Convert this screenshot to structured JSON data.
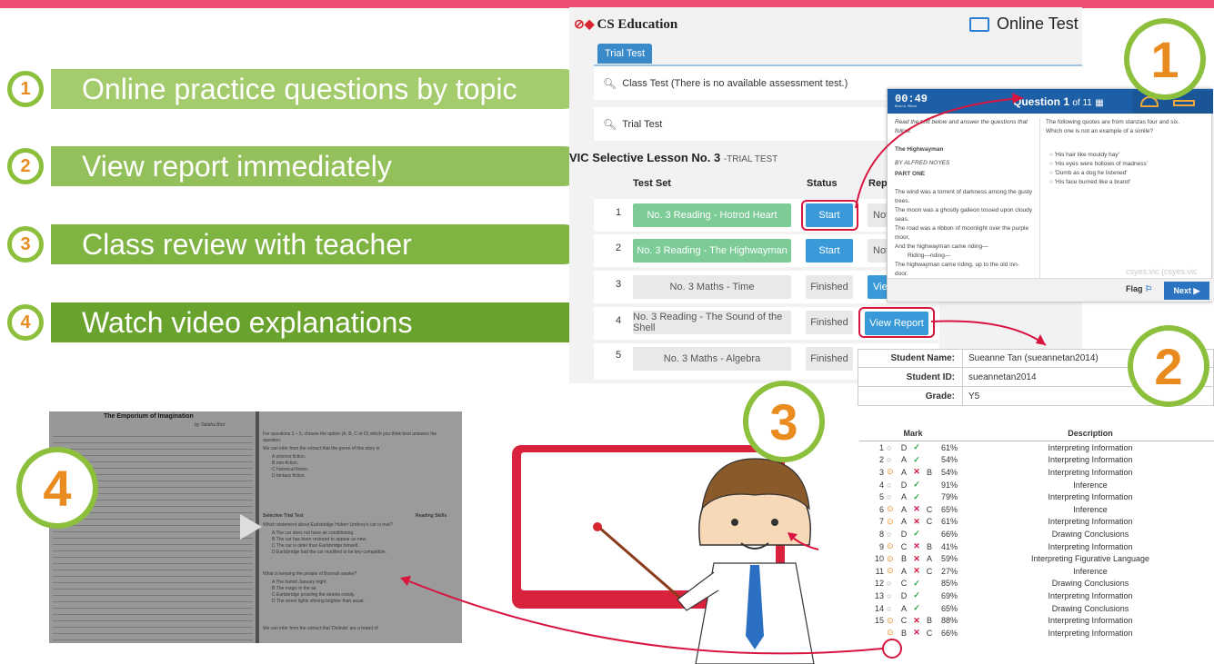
{
  "features": [
    {
      "num": "1",
      "text": "Online practice questions by topic"
    },
    {
      "num": "2",
      "text": "View report immediately"
    },
    {
      "num": "3",
      "text": "Class review with teacher"
    },
    {
      "num": "4",
      "text": "Watch video explanations"
    }
  ],
  "app": {
    "brand": "CS Education",
    "online": "Online Test",
    "tab": "Trial Test",
    "class_test": "Class Test (There is no available assessment test.)",
    "trial_test": "Trial Test",
    "lesson": "VIC Selective Lesson No. 3",
    "lesson_tag": "-TRIAL TEST",
    "headers": {
      "test_set": "Test Set",
      "status": "Status",
      "report": "Repo"
    },
    "rows": [
      {
        "n": "1",
        "name": "No. 3 Reading - Hotrod Heart",
        "status": "Start",
        "report": "Not"
      },
      {
        "n": "2",
        "name": "No. 3 Reading - The Highwayman",
        "status": "Start",
        "report": "Not"
      },
      {
        "n": "3",
        "name": "No. 3 Maths - Time",
        "status": "Finished",
        "report": "View"
      },
      {
        "n": "4",
        "name": "No. 3 Reading - The Sound of the Shell",
        "status": "Finished",
        "report": "View Report"
      },
      {
        "n": "5",
        "name": "No. 3 Maths - Algebra",
        "status": "Finished",
        "report": ""
      }
    ]
  },
  "question": {
    "timer": "00:49",
    "timer_units": "Hours Mins",
    "q_label": "Question 1",
    "q_of": "of 11",
    "left_text": [
      "Read the text below and answer the questions that",
      "follow.",
      "",
      "The Highwayman",
      "",
      "BY ALFRED NOYES",
      "",
      "PART ONE",
      "",
      "The wind was a torrent of darkness among the gusty",
      "trees.",
      "The moon was a ghostly galleon tossed upon cloudy",
      "seas.",
      "The road was a ribbon of moonlight over the purple",
      "moor,",
      "And the highwayman came riding—",
      "Riding—riding—",
      "The highwayman came riding, up to the old inn-",
      "door."
    ],
    "prompt": [
      "The following quotes are from stanzas four and six.",
      "Which one is not an example of a simile?"
    ],
    "options": [
      "'His hair like mouldy hay'",
      "'His eyes were hollows of madness'",
      "'Dumb as a dog he listened'",
      "'His face burned like a brand'"
    ],
    "flag": "Flag",
    "next": "Next",
    "watermark": "csyes.vic (csyes.vic"
  },
  "pins": {
    "p1": "1",
    "p2": "2",
    "p3": "3",
    "p4": "4"
  },
  "student": [
    {
      "k": "Student Name:",
      "v": "Sueanne Tan (sueannetan2014)"
    },
    {
      "k": "Student ID:",
      "v": "sueannetan2014"
    },
    {
      "k": "Grade:",
      "v": "Y5"
    }
  ],
  "mark": {
    "head_mark": "Mark",
    "head_desc": "Description",
    "rows": [
      {
        "n": "1",
        "a": "D",
        "r": "✓",
        "c": "",
        "p": "61%",
        "d": "Interpreting Information"
      },
      {
        "n": "2",
        "a": "A",
        "r": "✓",
        "c": "",
        "p": "54%",
        "d": "Interpreting Information"
      },
      {
        "n": "3",
        "a": "A",
        "r": "✕",
        "c": "B",
        "p": "54%",
        "d": "Interpreting Information"
      },
      {
        "n": "4",
        "a": "D",
        "r": "✓",
        "c": "",
        "p": "91%",
        "d": "Inference"
      },
      {
        "n": "5",
        "a": "A",
        "r": "✓",
        "c": "",
        "p": "79%",
        "d": "Interpreting Information"
      },
      {
        "n": "6",
        "a": "A",
        "r": "✕",
        "c": "C",
        "p": "65%",
        "d": "Inference"
      },
      {
        "n": "7",
        "a": "A",
        "r": "✕",
        "c": "C",
        "p": "61%",
        "d": "Interpreting Information"
      },
      {
        "n": "8",
        "a": "D",
        "r": "✓",
        "c": "",
        "p": "66%",
        "d": "Drawing Conclusions"
      },
      {
        "n": "9",
        "a": "C",
        "r": "✕",
        "c": "B",
        "p": "41%",
        "d": "Interpreting Information"
      },
      {
        "n": "10",
        "a": "B",
        "r": "✕",
        "c": "A",
        "p": "59%",
        "d": "Interpreting Figurative Language"
      },
      {
        "n": "11",
        "a": "A",
        "r": "✕",
        "c": "C",
        "p": "27%",
        "d": "Inference"
      },
      {
        "n": "12",
        "a": "C",
        "r": "✓",
        "c": "",
        "p": "85%",
        "d": "Drawing Conclusions"
      },
      {
        "n": "13",
        "a": "D",
        "r": "✓",
        "c": "",
        "p": "69%",
        "d": "Interpreting Information"
      },
      {
        "n": "14",
        "a": "A",
        "r": "✓",
        "c": "",
        "p": "65%",
        "d": "Drawing Conclusions"
      },
      {
        "n": "15",
        "a": "C",
        "r": "✕",
        "c": "B",
        "p": "88%",
        "d": "Interpreting Information"
      },
      {
        "n": "",
        "a": "B",
        "r": "✕",
        "c": "C",
        "p": "66%",
        "d": "Interpreting Information"
      }
    ]
  },
  "video": {
    "left_title": "The Emporium of Imagination",
    "left_author": "by Tabitha Bird",
    "right_heading": "For questions 1 – 5, choose the option (A, B, C or D) which you think best answers the question.",
    "q1": "We can infer from the extract that the genre of this story is",
    "q1_opts": [
      "A   science fiction.",
      "B   non-fiction.",
      "C   historical fiction.",
      "D   fantasy fiction."
    ],
    "trial": "Selective Trial Test",
    "skills": "Reading Skills",
    "q2": "Which statement about Earlsbridge Hubert Umbrey's car is true?",
    "q2_opts": [
      "A   The car does not have air conditioning.",
      "B   The car has been restored to appear as new.",
      "C   The car is older than Earlsbridge himself.",
      "D   Earlsbridge had the car modified to be key-compatible."
    ],
    "q3": "What is keeping the people of Boonah awake?",
    "q3_opts": [
      "A   The humid January night.",
      "B   The magic in the air.",
      "C   Earlsbridge prowling the streets noisily.",
      "D   The street lights shining brighter than usual."
    ],
    "q4": "We can infer from the extract that 'Delinda' are a brand of"
  },
  "colors": {
    "green": "#8bbf3c",
    "orange": "#ea8b1f",
    "red": "#d8153f",
    "pink": "#ee4d72",
    "blue": "#3a9ad9"
  }
}
